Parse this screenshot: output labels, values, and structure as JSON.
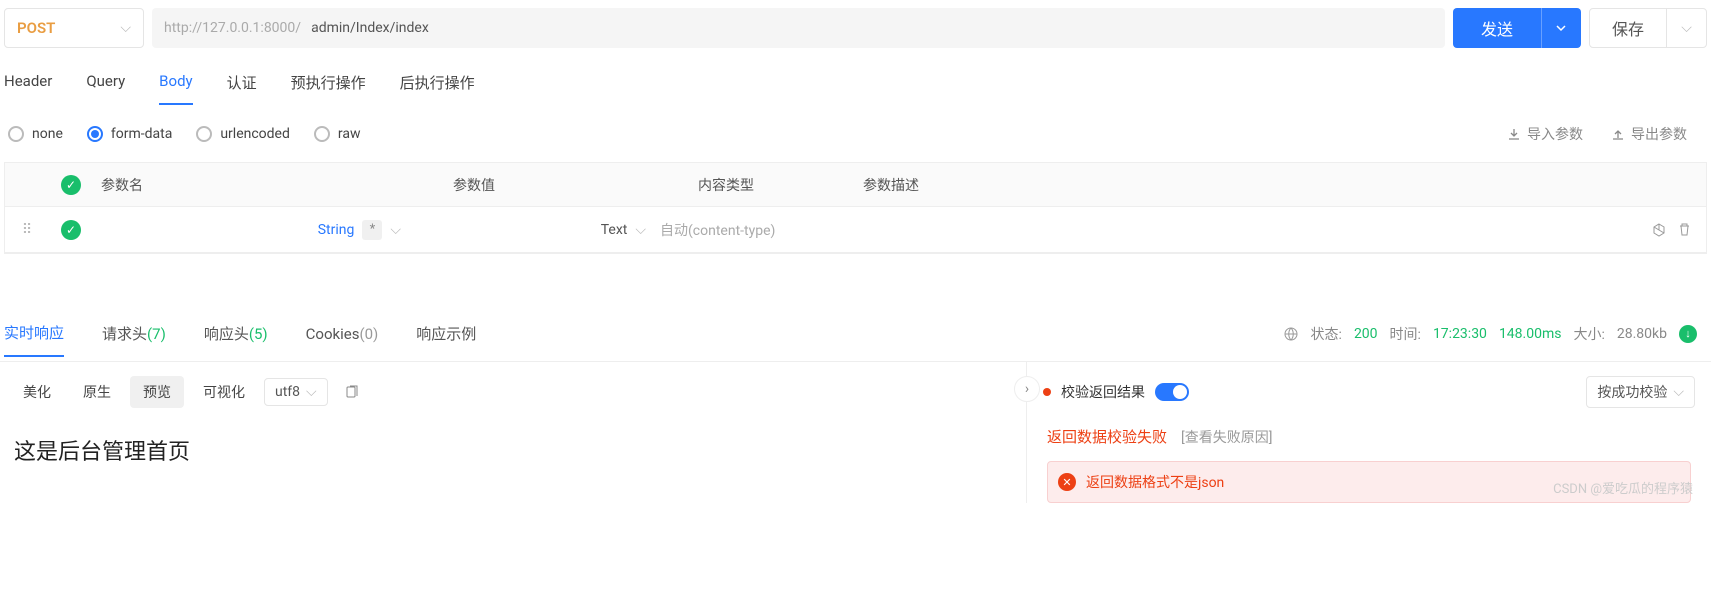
{
  "request": {
    "method": "POST",
    "url_prefix": "http://127.0.0.1:8000/",
    "url_path": "admin/Index/index",
    "send_label": "发送",
    "save_label": "保存"
  },
  "tabs": [
    "Header",
    "Query",
    "Body",
    "认证",
    "预执行操作",
    "后执行操作"
  ],
  "active_tab": "Body",
  "body_types": {
    "none": "none",
    "form_data": "form-data",
    "urlencoded": "urlencoded",
    "raw": "raw"
  },
  "io": {
    "import": "导入参数",
    "export": "导出参数"
  },
  "table": {
    "headers": {
      "name": "参数名",
      "value": "参数值",
      "ctype": "内容类型",
      "desc": "参数描述"
    },
    "row": {
      "type_label": "String",
      "value_type": "Text",
      "ctype_placeholder": "自动(content-type)"
    }
  },
  "response": {
    "tabs": {
      "realtime": "实时响应",
      "req_headers": {
        "label": "请求头",
        "count": "(7)"
      },
      "resp_headers": {
        "label": "响应头",
        "count": "(5)"
      },
      "cookies": {
        "label": "Cookies",
        "count": "(0)"
      },
      "example": "响应示例"
    },
    "meta": {
      "status_label": "状态:",
      "status_code": "200",
      "time_label": "时间:",
      "time_value": "17:23:30",
      "duration": "148.00ms",
      "size_label": "大小:",
      "size_value": "28.80kb"
    },
    "sub_tabs": {
      "beautify": "美化",
      "raw": "原生",
      "preview": "预览",
      "visualize": "可视化"
    },
    "encoding": "utf8",
    "body_text": "这是后台管理首页"
  },
  "validation": {
    "label": "校验返回结果",
    "success_label": "按成功校验",
    "fail_title": "返回数据校验失败",
    "fail_link": "[查看失败原因]",
    "error_msg": "返回数据格式不是json"
  },
  "watermark": "CSDN @爱吃瓜的程序猿"
}
